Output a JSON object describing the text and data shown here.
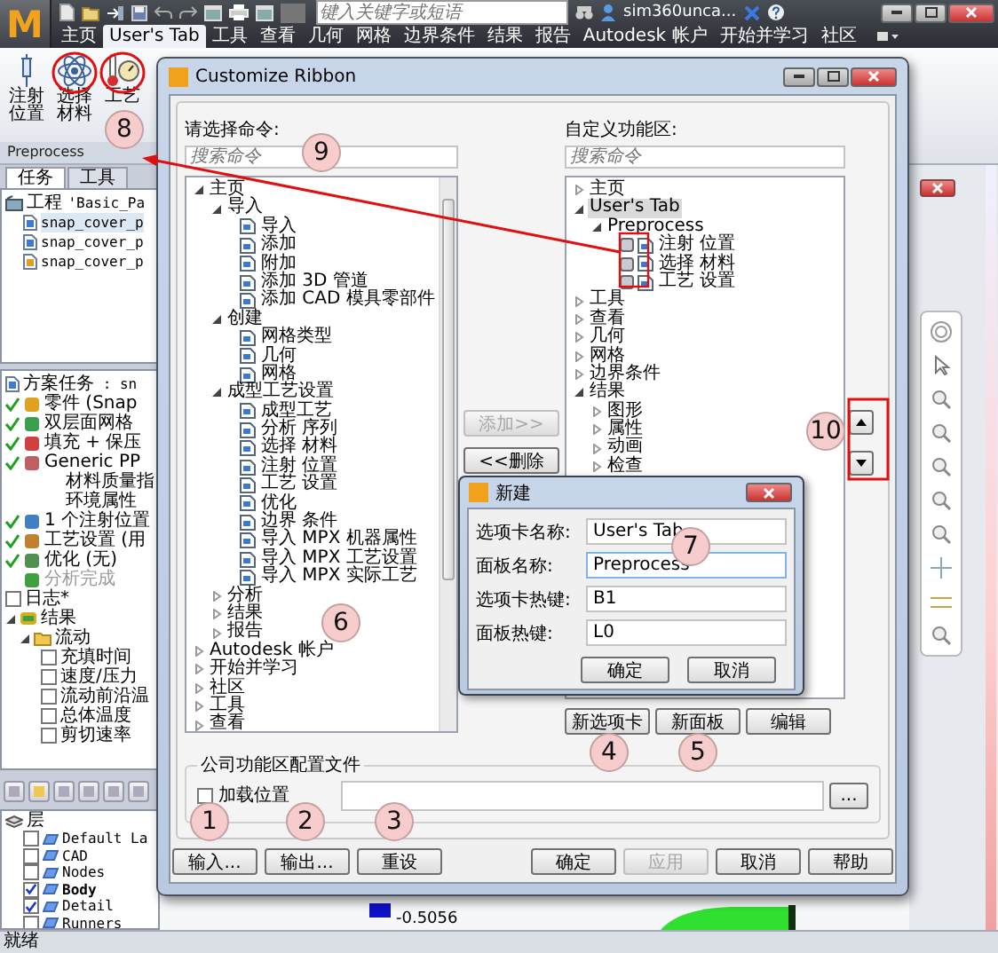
{
  "app": {
    "logo": "M",
    "search": {
      "placeholder": "键入关键字或短语"
    },
    "user": "sim360unca...",
    "menu_tabs": [
      {
        "label": "主页",
        "selected": false
      },
      {
        "label": "User's Tab",
        "selected": true
      },
      {
        "label": "工具",
        "selected": false
      },
      {
        "label": "查看",
        "selected": false
      },
      {
        "label": "几何",
        "selected": false
      },
      {
        "label": "网格",
        "selected": false
      },
      {
        "label": "边界条件",
        "selected": false
      },
      {
        "label": "结果",
        "selected": false
      },
      {
        "label": "报告",
        "selected": false
      },
      {
        "label": "Autodesk 帐户",
        "selected": false
      },
      {
        "label": "开始并学习",
        "selected": false
      },
      {
        "label": "社区",
        "selected": false
      }
    ],
    "ribbon": {
      "buttons": [
        {
          "label": "注射位置",
          "kind": "syringe"
        },
        {
          "label": "选择材料",
          "kind": "material"
        },
        {
          "label": "工艺",
          "kind": "thermometer"
        }
      ],
      "panel_label": "Preprocess"
    }
  },
  "left_panel": {
    "tabs": [
      {
        "label": "任务",
        "selected": true
      },
      {
        "label": "工具",
        "selected": false
      }
    ],
    "project": {
      "label": "工程 'Basic_Pa",
      "children": [
        {
          "label": "snap_cover_p",
          "selected": true
        },
        {
          "label": "snap_cover_p",
          "selected": false
        },
        {
          "label": "snap_cover_p",
          "selected": false
        }
      ]
    },
    "tasks": [
      {
        "label": "方案任务 : sn",
        "kind": "header"
      },
      {
        "label": "零件 (Snap",
        "kind": "task",
        "done": true
      },
      {
        "label": "双层面网格",
        "kind": "task",
        "done": true
      },
      {
        "label": "填充 + 保压",
        "kind": "task",
        "done": true
      },
      {
        "label": "Generic PP",
        "kind": "task",
        "done": true,
        "children": [
          {
            "label": "材料质量指"
          },
          {
            "label": "环境属性"
          }
        ]
      },
      {
        "label": "1 个注射位置",
        "kind": "task",
        "done": true
      },
      {
        "label": "工艺设置 (用",
        "kind": "task",
        "done": true
      },
      {
        "label": "优化 (无)",
        "kind": "task",
        "done": true
      },
      {
        "label": "分析完成",
        "kind": "task",
        "done": false
      }
    ],
    "log": {
      "label": "日志*",
      "checked": false
    },
    "results": {
      "label": "结果",
      "expanded": true,
      "children": [
        {
          "label": "流动",
          "expanded": true,
          "children": [
            {
              "label": "充填时间",
              "checked": false
            },
            {
              "label": "速度/压力",
              "checked": false
            },
            {
              "label": "流动前沿温",
              "checked": false
            },
            {
              "label": "总体温度",
              "checked": false
            },
            {
              "label": "剪切速率",
              "checked": false
            }
          ]
        }
      ]
    },
    "layers": {
      "label": "层",
      "items": [
        {
          "label": "Default La",
          "checked": false,
          "active": false
        },
        {
          "label": "CAD",
          "checked": false,
          "active": false
        },
        {
          "label": "Nodes",
          "checked": false,
          "active": false
        },
        {
          "label": "Body",
          "checked": true,
          "active": true
        },
        {
          "label": "Detail",
          "checked": true,
          "active": false
        },
        {
          "label": "Runners",
          "checked": false,
          "active": false
        }
      ]
    }
  },
  "viewport": {
    "legend_value": "-0.5056"
  },
  "status_bar": "就绪",
  "dialog": {
    "title": "Customize Ribbon",
    "commands_label": "请选择命令:",
    "commands_search": {
      "placeholder": "搜索命令"
    },
    "commands_tree": [
      {
        "label": "主页",
        "expanded": true,
        "children": [
          {
            "label": "导入",
            "expanded": true,
            "children": [
              {
                "label": "导入"
              },
              {
                "label": "添加"
              },
              {
                "label": "附加"
              },
              {
                "label": "添加 3D 管道"
              },
              {
                "label": "添加 CAD 模具零部件"
              }
            ]
          },
          {
            "label": "创建",
            "expanded": true,
            "children": [
              {
                "label": "网格类型"
              },
              {
                "label": "几何"
              },
              {
                "label": "网格"
              }
            ]
          },
          {
            "label": "成型工艺设置",
            "expanded": true,
            "children": [
              {
                "label": "成型工艺"
              },
              {
                "label": "分析 序列"
              },
              {
                "label": "选择 材料"
              },
              {
                "label": "注射 位置"
              },
              {
                "label": "工艺 设置"
              },
              {
                "label": "优化"
              },
              {
                "label": "边界 条件"
              },
              {
                "label": "导入 MPX 机器属性"
              },
              {
                "label": "导入 MPX 工艺设置"
              },
              {
                "label": "导入 MPX 实际工艺"
              }
            ]
          },
          {
            "label": "分析",
            "expanded": false
          },
          {
            "label": "结果",
            "expanded": false
          },
          {
            "label": "报告",
            "expanded": false
          }
        ]
      },
      {
        "label": "Autodesk 帐户",
        "expanded": false
      },
      {
        "label": "开始并学习",
        "expanded": false
      },
      {
        "label": "社区",
        "expanded": false
      },
      {
        "label": "工具",
        "expanded": false
      },
      {
        "label": "查看",
        "expanded": false
      }
    ],
    "add_button": {
      "label": "添加>>",
      "disabled": true
    },
    "remove_button": {
      "label": "<<删除",
      "disabled": false
    },
    "ribbon_label": "自定义功能区:",
    "ribbon_search": {
      "placeholder": "搜索命令"
    },
    "ribbon_tree": [
      {
        "label": "主页",
        "expanded": false,
        "selected": false
      },
      {
        "label": "User's Tab",
        "expanded": true,
        "selected": true,
        "children": [
          {
            "label": "Preprocess",
            "expanded": true,
            "selected": false,
            "children": [
              {
                "label": "注射 位置",
                "selected": false
              },
              {
                "label": "选择 材料",
                "selected": false
              },
              {
                "label": "工艺 设置",
                "selected": false
              }
            ]
          }
        ]
      },
      {
        "label": "工具",
        "expanded": false,
        "selected": false
      },
      {
        "label": "查看",
        "expanded": false,
        "selected": false
      },
      {
        "label": "几何",
        "expanded": false,
        "selected": false
      },
      {
        "label": "网格",
        "expanded": false,
        "selected": false
      },
      {
        "label": "边界条件",
        "expanded": false,
        "selected": false
      },
      {
        "label": "结果",
        "expanded": true,
        "selected": false,
        "children": [
          {
            "label": "图形",
            "expanded": false,
            "selected": false
          },
          {
            "label": "属性",
            "expanded": false,
            "selected": false
          },
          {
            "label": "动画",
            "expanded": false,
            "selected": false
          },
          {
            "label": "检查",
            "expanded": false,
            "selected": false
          }
        ]
      }
    ],
    "tree_buttons": [
      "新选项卡",
      "新面板",
      "编辑"
    ],
    "profile": {
      "title": "公司功能区配置文件",
      "checkbox": {
        "label": "加载位置",
        "checked": false
      },
      "browse": "..."
    },
    "left_buttons": [
      "输入...",
      "输出...",
      "重设"
    ],
    "footer_buttons": [
      {
        "label": "确定",
        "disabled": false
      },
      {
        "label": "应用",
        "disabled": true
      },
      {
        "label": "取消",
        "disabled": false
      },
      {
        "label": "帮助",
        "disabled": false
      }
    ]
  },
  "new_dialog": {
    "title": "新建",
    "fields": [
      {
        "label": "选项卡名称:",
        "value": "User's Tab",
        "focused": false
      },
      {
        "label": "面板名称:",
        "value": "Preprocess",
        "focused": true
      },
      {
        "label": "选项卡热键:",
        "value": "B1",
        "focused": false
      },
      {
        "label": "面板热键:",
        "value": "L0",
        "focused": false
      }
    ],
    "buttons": [
      "确定",
      "取消"
    ]
  },
  "callouts": [
    {
      "label": "1"
    },
    {
      "label": "2"
    },
    {
      "label": "3"
    },
    {
      "label": "4"
    },
    {
      "label": "5"
    },
    {
      "label": "6"
    },
    {
      "label": "7"
    },
    {
      "label": "8"
    },
    {
      "label": "9"
    },
    {
      "label": "10"
    }
  ]
}
